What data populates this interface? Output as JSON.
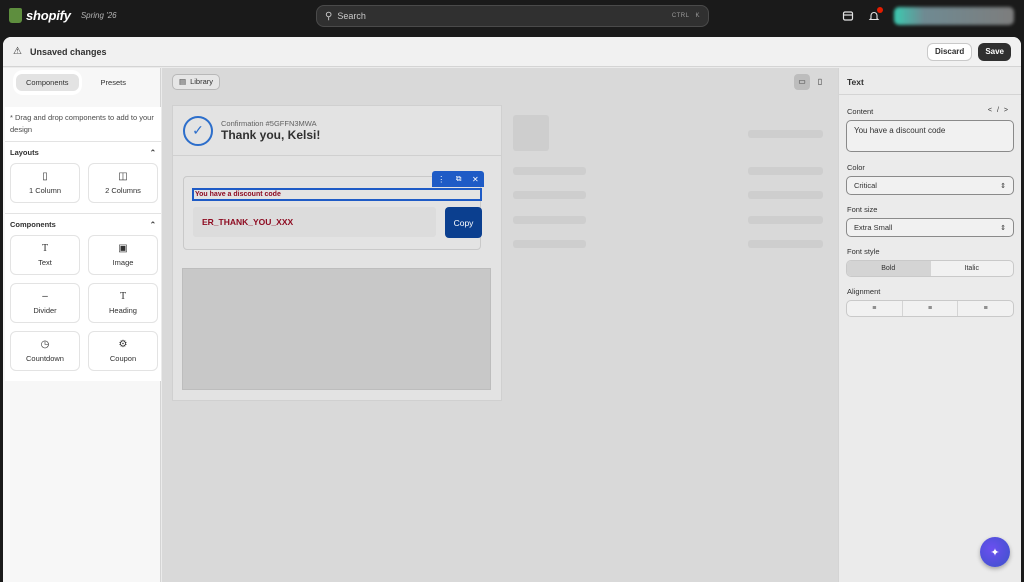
{
  "topbar": {
    "brand": "shopify",
    "season": "Spring '26",
    "search_placeholder": "Search",
    "shortcut_ctrl": "CTRL",
    "shortcut_key": "K"
  },
  "savebar": {
    "title": "Unsaved changes",
    "discard_label": "Discard",
    "save_label": "Save"
  },
  "left_panel": {
    "tabs": [
      "Components",
      "Presets"
    ],
    "active_tab": "Components",
    "hint": "* Drag and drop components to add to your design",
    "layouts_title": "Layouts",
    "layouts": [
      {
        "label": "1 Column",
        "icon": "one-column-icon"
      },
      {
        "label": "2 Columns",
        "icon": "two-columns-icon"
      }
    ],
    "components_title": "Components",
    "components": [
      {
        "label": "Text",
        "icon": "text-icon"
      },
      {
        "label": "Image",
        "icon": "image-icon"
      },
      {
        "label": "Divider",
        "icon": "divider-icon"
      },
      {
        "label": "Heading",
        "icon": "heading-icon"
      },
      {
        "label": "Countdown",
        "icon": "clock-icon"
      },
      {
        "label": "Coupon",
        "icon": "coupon-icon"
      }
    ]
  },
  "canvas": {
    "library_label": "Library",
    "confirmation_number": "Confirmation #5GFFN3MWA",
    "thank_you": "Thank you, Kelsi!",
    "discount_text": "You have a discount code",
    "discount_code": "ER_THANK_YOU_XXX",
    "copy_label": "Copy"
  },
  "right_panel": {
    "title": "Text",
    "content_label": "Content",
    "content_value": "You have a discount code",
    "color_label": "Color",
    "color_value": "Critical",
    "font_size_label": "Font size",
    "font_size_value": "Extra Small",
    "font_style_label": "Font style",
    "font_style_options": [
      "Bold",
      "Italic"
    ],
    "font_style_selected": "Bold",
    "alignment_label": "Alignment"
  },
  "colors": {
    "accent": "#1e5bc6",
    "critical": "#8e0b21",
    "brand_green": "#5e8e3e"
  }
}
